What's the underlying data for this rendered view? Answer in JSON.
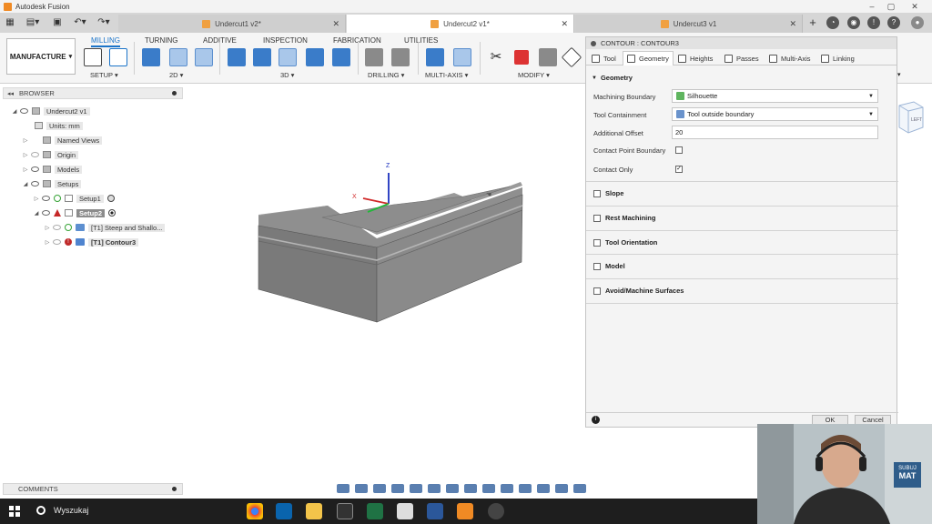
{
  "window": {
    "title": "Autodesk Fusion"
  },
  "tabs": [
    {
      "label": "Undercut1 v2*",
      "active": false
    },
    {
      "label": "Undercut2 v1*",
      "active": true
    },
    {
      "label": "Undercut3 v1",
      "active": false
    }
  ],
  "ribbon": {
    "workspace": "MANUFACTURE",
    "tabs": [
      "MILLING",
      "TURNING",
      "ADDITIVE",
      "INSPECTION",
      "FABRICATION",
      "UTILITIES"
    ],
    "active_tab": "MILLING",
    "groups": [
      "SETUP",
      "2D",
      "3D",
      "DRILLING",
      "MULTI-AXIS",
      "MODIFY"
    ]
  },
  "browser": {
    "title": "BROWSER",
    "items": [
      {
        "label": "Undercut2 v1"
      },
      {
        "label": "Units: mm"
      },
      {
        "label": "Named Views"
      },
      {
        "label": "Origin"
      },
      {
        "label": "Models"
      },
      {
        "label": "Setups"
      },
      {
        "label": "Setup1"
      },
      {
        "label": "Setup2",
        "selected": true
      },
      {
        "label": "[T1] Steep and Shallo..."
      },
      {
        "label": "[T1] Contour3",
        "warning": true
      }
    ]
  },
  "dialog": {
    "title": "CONTOUR : CONTOUR3",
    "tabs": [
      "Tool",
      "Geometry",
      "Heights",
      "Passes",
      "Multi-Axis",
      "Linking"
    ],
    "active_tab": "Geometry",
    "section": "Geometry",
    "fields": {
      "machining_boundary_label": "Machining Boundary",
      "machining_boundary_value": "Silhouette",
      "tool_containment_label": "Tool Containment",
      "tool_containment_value": "Tool outside boundary",
      "additional_offset_label": "Additional Offset",
      "additional_offset_value": "20",
      "contact_point_boundary_label": "Contact Point Boundary",
      "contact_point_boundary_checked": false,
      "contact_only_label": "Contact Only",
      "contact_only_checked": true
    },
    "groups": [
      "Slope",
      "Rest Machining",
      "Tool Orientation",
      "Model",
      "Avoid/Machine Surfaces"
    ],
    "ok_label": "OK",
    "cancel_label": "Cancel"
  },
  "viewcube": {
    "face": "LEFT"
  },
  "axes": {
    "z": "Z",
    "x": "X"
  },
  "comments": {
    "label": "COMMENTS"
  },
  "taskbar": {
    "search": "Wyszukaj"
  },
  "webcam": {
    "badge_line1": "SUBUJ",
    "badge_line2": "MAT"
  },
  "colors": {
    "accent": "#1b74c9",
    "model_face": "#8c8c8c",
    "warning": "#c02a2a"
  }
}
